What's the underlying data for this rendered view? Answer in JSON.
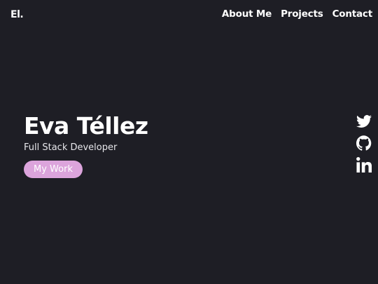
{
  "header": {
    "logo": "El.",
    "nav": [
      {
        "label": "About Me"
      },
      {
        "label": "Projects"
      },
      {
        "label": "Contact"
      }
    ]
  },
  "hero": {
    "name": "Eva Téllez",
    "role": "Full Stack Developer",
    "cta_label": "My Work"
  },
  "social": [
    {
      "icon": "twitter-icon"
    },
    {
      "icon": "github-icon"
    },
    {
      "icon": "linkedin-icon"
    }
  ],
  "colors": {
    "background": "#1e1e25",
    "text": "#ffffff",
    "accent": "#dca4dc"
  }
}
